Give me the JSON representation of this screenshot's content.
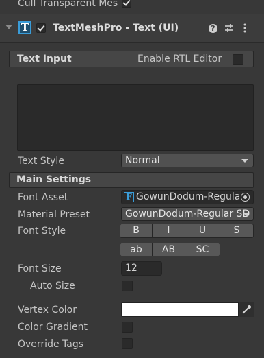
{
  "top_row": {
    "label": "Cull Transparent Mes",
    "checked": true
  },
  "component": {
    "title": "TextMeshPro - Text (UI)",
    "enabled": true,
    "icon_letter": "T",
    "help_icon": "help-icon",
    "presets_icon": "presets-icon",
    "menu_icon": "kebab-menu-icon"
  },
  "text_input": {
    "header": "Text Input",
    "rtl_label": "Enable RTL Editor",
    "rtl_checked": false,
    "value": ""
  },
  "text_style": {
    "label": "Text Style",
    "value": "Normal"
  },
  "main_settings": {
    "header": "Main Settings",
    "font_asset": {
      "label": "Font Asset",
      "value": "GowunDodum-Regula",
      "icon_letter": "F"
    },
    "material_preset": {
      "label": "Material Preset",
      "value": "GowunDodum-Regular SD"
    },
    "font_style": {
      "label": "Font Style",
      "row1": [
        "B",
        "I",
        "U",
        "S"
      ],
      "row2": [
        "ab",
        "AB",
        "SC"
      ]
    },
    "font_size": {
      "label": "Font Size",
      "value": "12"
    },
    "auto_size": {
      "label": "Auto Size",
      "checked": false
    },
    "vertex_color": {
      "label": "Vertex Color",
      "value": "#ffffff"
    },
    "color_gradient": {
      "label": "Color Gradient",
      "checked": false
    },
    "override_tags": {
      "label": "Override Tags",
      "checked": false
    }
  }
}
